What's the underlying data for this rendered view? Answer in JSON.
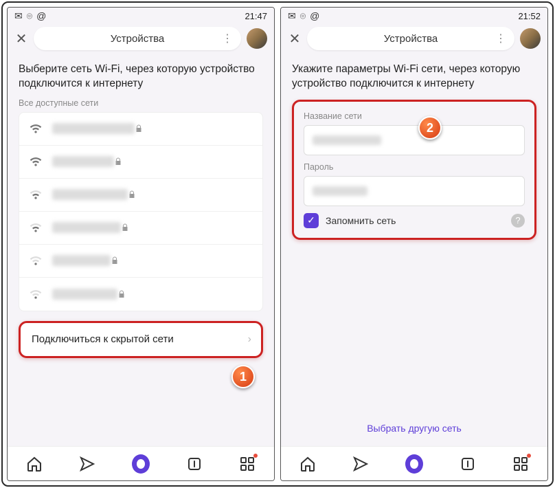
{
  "left": {
    "status": {
      "time": "21:47"
    },
    "title": "Устройства",
    "heading": "Выберите сеть Wi-Fi, через которую устройство подключится к интернету",
    "all_networks_label": "Все доступные сети",
    "hidden_net_label": "Подключиться к скрытой сети",
    "callout": "1"
  },
  "right": {
    "status": {
      "time": "21:52"
    },
    "title": "Устройства",
    "heading": "Укажите параметры Wi-Fi сети, через которую устройство подключится к интернету",
    "ssid_label": "Название сети",
    "pwd_label": "Пароль",
    "remember_label": "Запомнить сеть",
    "other_net": "Выбрать другую сеть",
    "callout": "2"
  }
}
